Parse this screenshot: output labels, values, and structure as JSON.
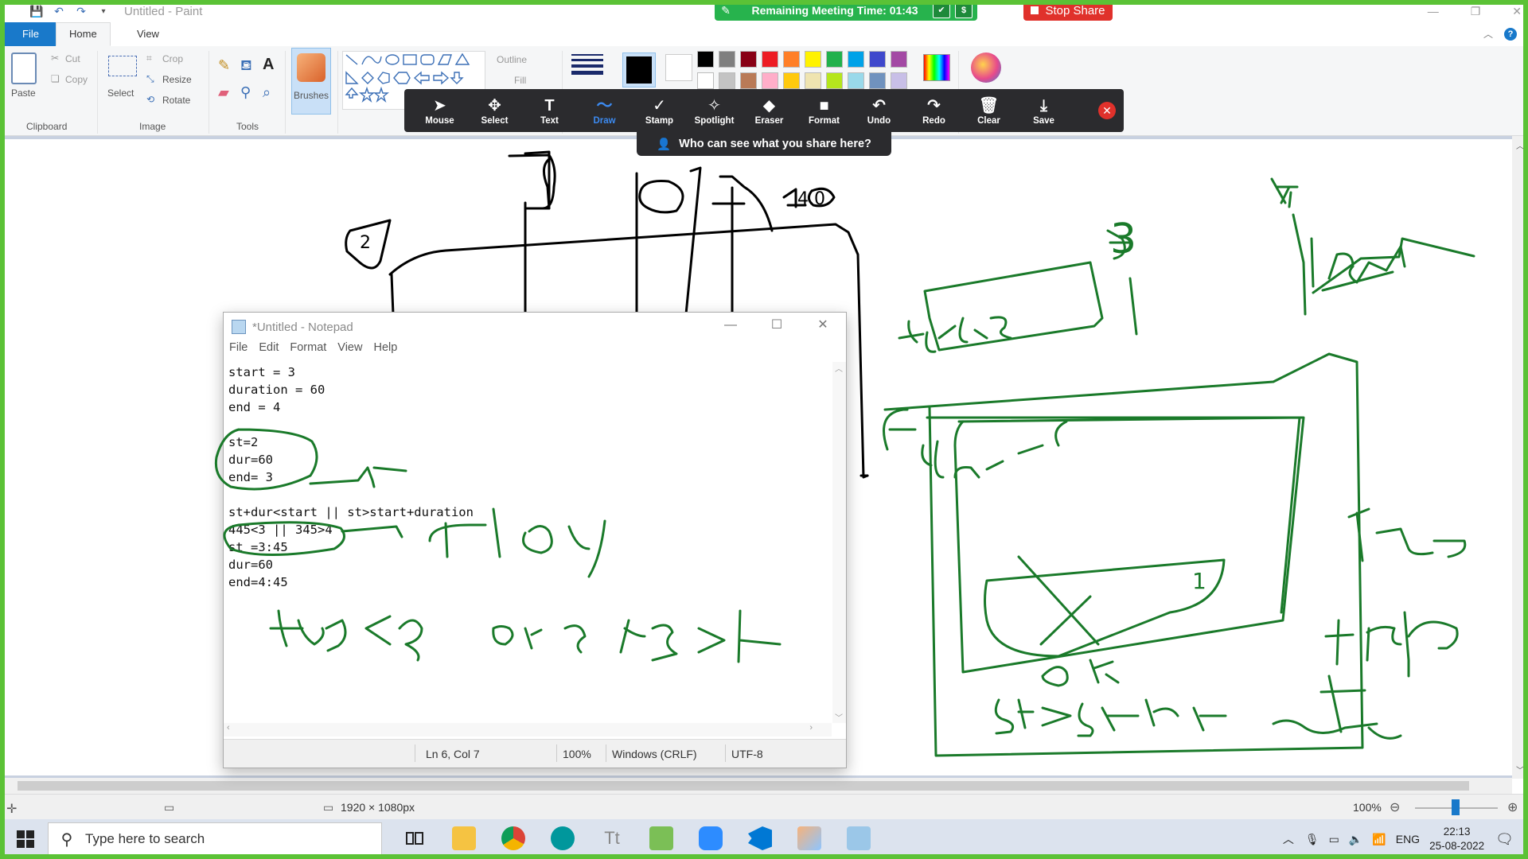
{
  "window": {
    "title": "Untitled - Paint"
  },
  "ribbon": {
    "tabs": {
      "file": "File",
      "home": "Home",
      "view": "View"
    },
    "clipboard": {
      "paste": "Paste",
      "cut": "Cut",
      "copy": "Copy",
      "label": "Clipboard"
    },
    "image": {
      "select": "Select",
      "crop": "Crop",
      "resize": "Resize",
      "rotate": "Rotate",
      "label": "Image"
    },
    "tools": {
      "label": "Tools",
      "text_tool": "A"
    },
    "brushes": "Brushes",
    "shapes": {
      "outline": "Outline",
      "fill": "Fill"
    }
  },
  "palette": [
    "#000000",
    "#7f7f7f",
    "#880015",
    "#ed1c24",
    "#ff7f27",
    "#fff200",
    "#22b14c",
    "#00a2e8",
    "#3f48cc",
    "#a349a4",
    "#ffffff",
    "#c3c3c3",
    "#b97a57",
    "#ffaec9",
    "#ffc90e",
    "#efe4b0",
    "#b5e61d",
    "#99d9ea",
    "#7092be",
    "#c8bfe7"
  ],
  "meeting": {
    "remaining": "Remaining Meeting Time: 01:43",
    "stop_share": "Stop Share",
    "who_can_see": "Who can see what you share here?"
  },
  "annotation_tools": [
    {
      "label": "Mouse",
      "glyph": "➤"
    },
    {
      "label": "Select",
      "glyph": "✥"
    },
    {
      "label": "Text",
      "glyph": "T"
    },
    {
      "label": "Draw",
      "glyph": "〜"
    },
    {
      "label": "Stamp",
      "glyph": "✓"
    },
    {
      "label": "Spotlight",
      "glyph": "✧"
    },
    {
      "label": "Eraser",
      "glyph": "◆"
    },
    {
      "label": "Format",
      "glyph": "■"
    },
    {
      "label": "Undo",
      "glyph": "↶"
    },
    {
      "label": "Redo",
      "glyph": "↷"
    },
    {
      "label": "Clear",
      "glyph": "🗑"
    },
    {
      "label": "Save",
      "glyph": "⤓"
    }
  ],
  "notepad": {
    "title": "*Untitled - Notepad",
    "menu": [
      "File",
      "Edit",
      "Format",
      "View",
      "Help"
    ],
    "lines": [
      "start = 3",
      "duration = 60",
      "end = 4",
      "",
      "st=2",
      "dur=60",
      "end= 3",
      "",
      "st+dur<start || st>start+duration",
      "445<3 || 345>4",
      "st =3:45",
      "dur=60",
      "end=4:45"
    ],
    "status": {
      "position": "Ln 6, Col 7",
      "zoom": "100%",
      "line_ending": "Windows (CRLF)",
      "encoding": "UTF-8"
    }
  },
  "ink_labels": [
    "3",
    "2",
    "4",
    "4.0",
    "3",
    "4",
    "st+dur<3",
    "st>4",
    "st+dur<start",
    "OR",
    "st>start+dur",
    "True",
    "false",
    "445<3  or 3 45>4",
    "false",
    "1"
  ],
  "status": {
    "dimensions": "1920 × 1080px",
    "zoom": "100%"
  },
  "taskbar": {
    "search_placeholder": "Type here to search",
    "lang": "ENG",
    "time": "22:13",
    "date": "25-08-2022"
  }
}
